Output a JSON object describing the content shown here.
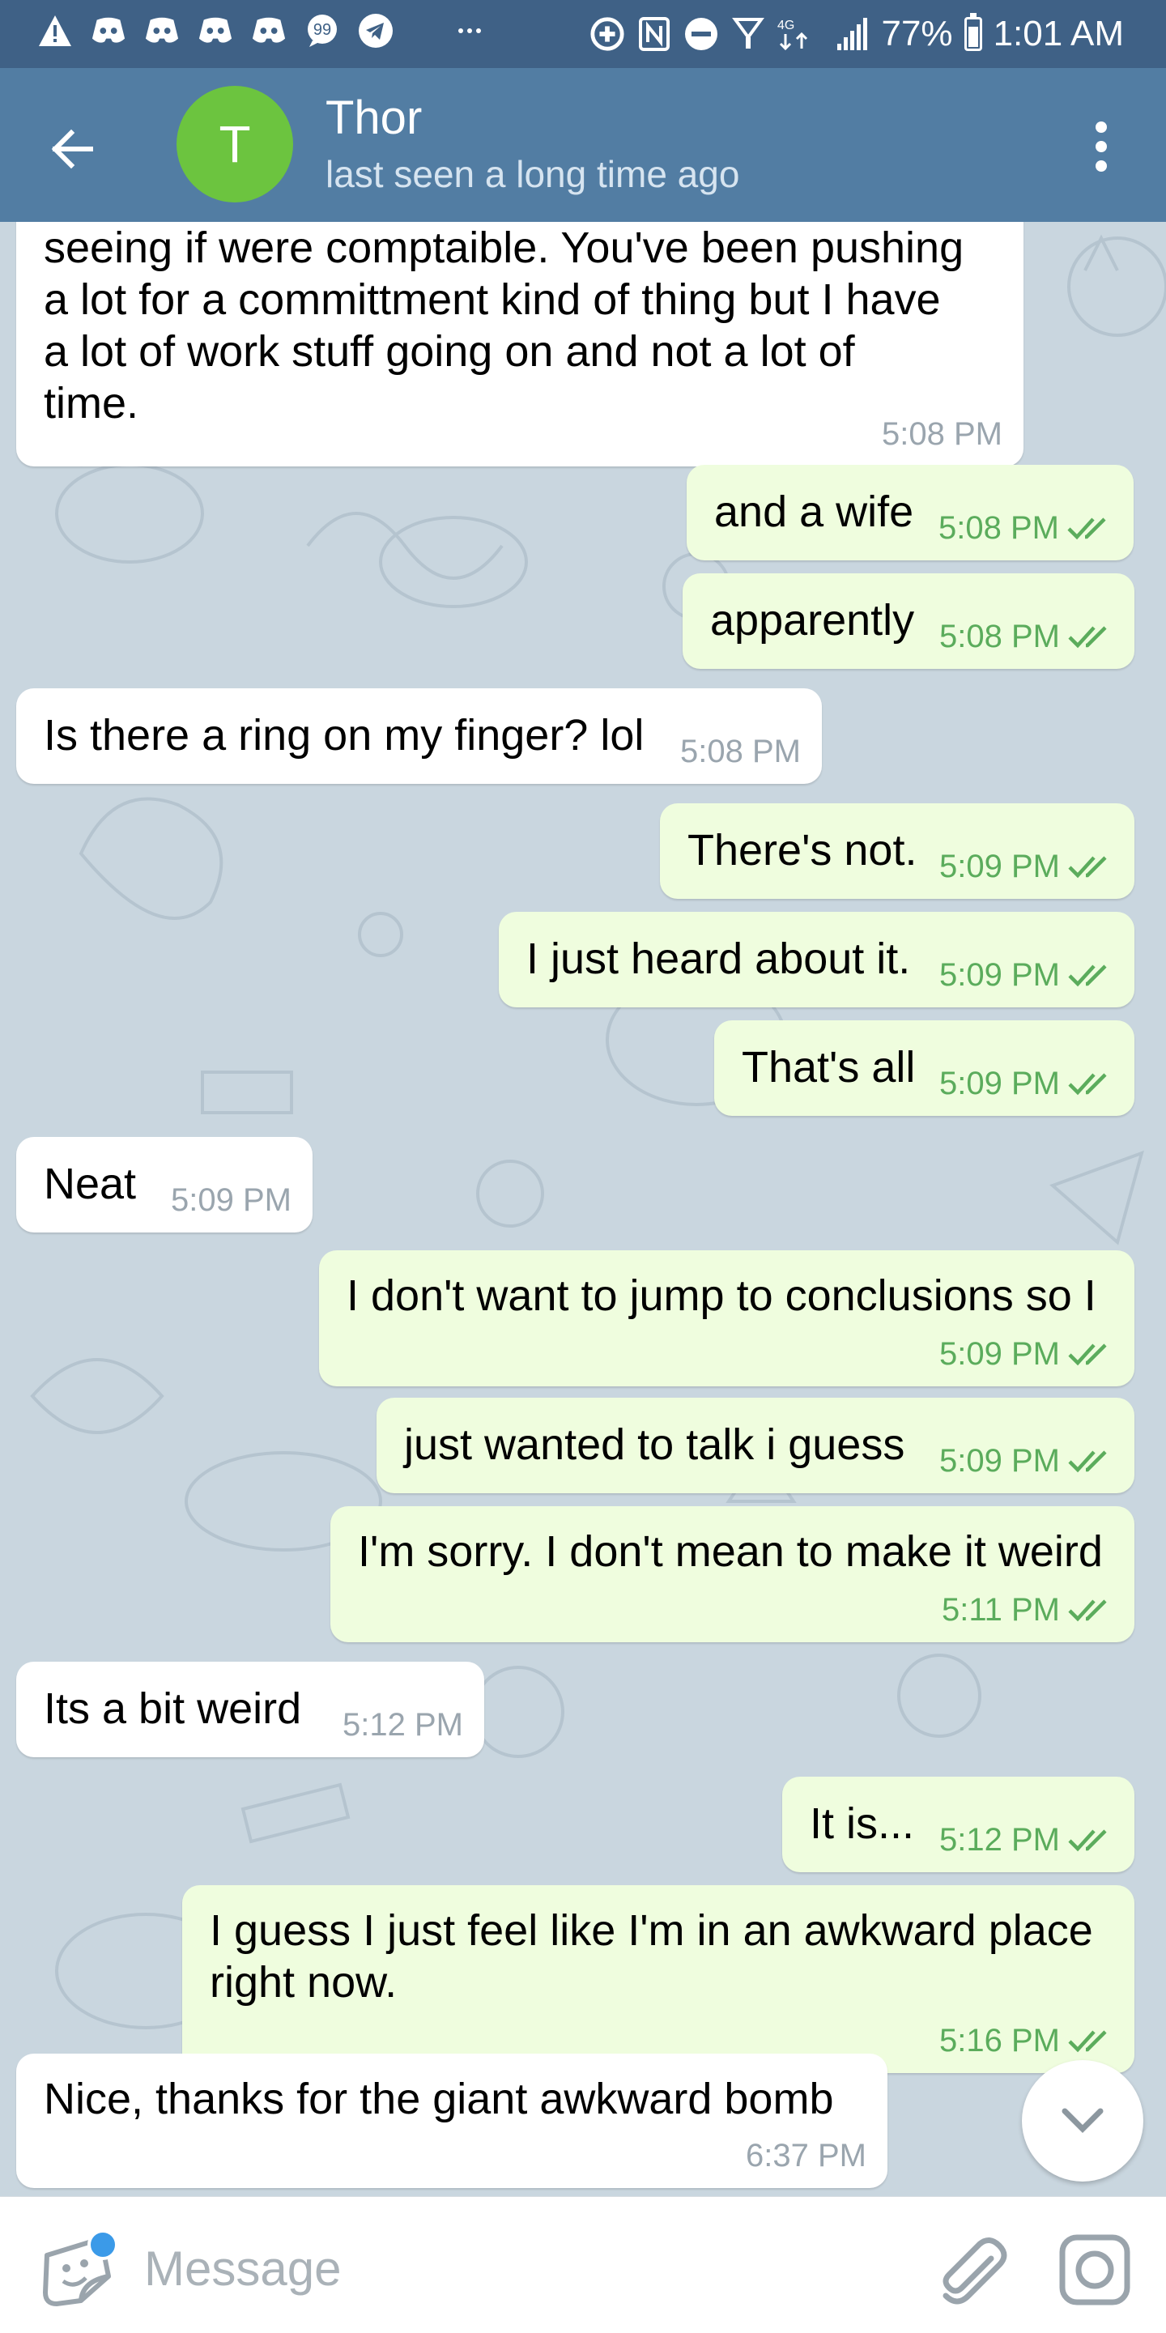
{
  "status_bar": {
    "icons": [
      "warning-icon",
      "discord-icon",
      "discord-icon",
      "discord-icon",
      "discord-icon",
      "chat-icon",
      "telegram-icon",
      "more-icon",
      "data-saver-icon",
      "nfc-icon",
      "do-not-disturb-icon",
      "wifi-icon",
      "lte-icon",
      "signal-icon"
    ],
    "network": "4G",
    "battery": "77%",
    "battery_level": 0.77,
    "time": "1:01 AM"
  },
  "header": {
    "avatar_letter": "T",
    "avatar_color": "#6cc43f",
    "name": "Thor",
    "status": "last seen a long time ago"
  },
  "messages": [
    {
      "dir": "in",
      "lines": [
        "seeing if were comptaible. You've been pushing",
        "a lot for a committment kind of thing but I have",
        "a lot of work stuff going on and not a lot of",
        "time."
      ],
      "time": "5:08 PM"
    },
    {
      "dir": "out",
      "lines": [
        "and a wife"
      ],
      "time": "5:08 PM"
    },
    {
      "dir": "out",
      "lines": [
        "apparently"
      ],
      "time": "5:08 PM"
    },
    {
      "dir": "in",
      "lines": [
        "Is there a ring on my finger? lol"
      ],
      "time": "5:08 PM"
    },
    {
      "dir": "out",
      "lines": [
        "There's not."
      ],
      "time": "5:09 PM"
    },
    {
      "dir": "out",
      "lines": [
        "I just heard about it."
      ],
      "time": "5:09 PM"
    },
    {
      "dir": "out",
      "lines": [
        "That's all"
      ],
      "time": "5:09 PM"
    },
    {
      "dir": "in",
      "lines": [
        "Neat"
      ],
      "time": "5:09 PM"
    },
    {
      "dir": "out",
      "lines": [
        "I don't want to jump to conclusions so I"
      ],
      "time": "5:09 PM"
    },
    {
      "dir": "out",
      "lines": [
        "just wanted to talk i guess"
      ],
      "time": "5:09 PM"
    },
    {
      "dir": "out",
      "lines": [
        "I'm sorry. I don't mean to make it weird"
      ],
      "time": "5:11 PM"
    },
    {
      "dir": "in",
      "lines": [
        "Its a bit weird"
      ],
      "time": "5:12 PM"
    },
    {
      "dir": "out",
      "lines": [
        "It is..."
      ],
      "time": "5:12 PM"
    },
    {
      "dir": "out",
      "lines": [
        "I guess I just feel like I'm in an awkward place",
        "right now."
      ],
      "time": "5:16 PM"
    },
    {
      "dir": "in",
      "lines": [
        "Nice, thanks for the giant awkward bomb"
      ],
      "time": "6:37 PM"
    }
  ],
  "input": {
    "placeholder": "Message",
    "value": ""
  },
  "colors": {
    "status_bar": "#3f6186",
    "header": "#527da3",
    "outgoing_bubble": "#effdde",
    "incoming_bubble": "#ffffff",
    "chat_background": "#c9d6df",
    "check_color": "#5bac5c"
  }
}
